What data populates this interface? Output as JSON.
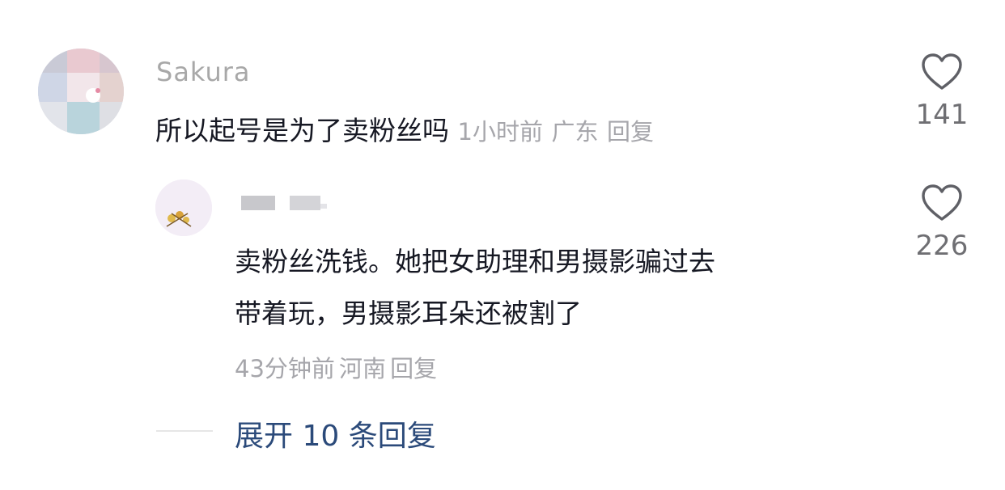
{
  "comment": {
    "username": "Sakura",
    "text": "所以起号是为了卖粉丝吗",
    "time": "1小时前",
    "location": "广东",
    "reply_label": "回复",
    "likes": "141"
  },
  "reply": {
    "username": "",
    "text_line1": "卖粉丝洗钱。她把女助理和男摄影骗过去",
    "text_line2": "带着玩，男摄影耳朵还被割了",
    "time": "43分钟前",
    "location": "河南",
    "reply_label": "回复",
    "likes": "226"
  },
  "expand": {
    "label": "展开 10 条回复"
  },
  "icons": {
    "like": "heart-outline-icon"
  }
}
